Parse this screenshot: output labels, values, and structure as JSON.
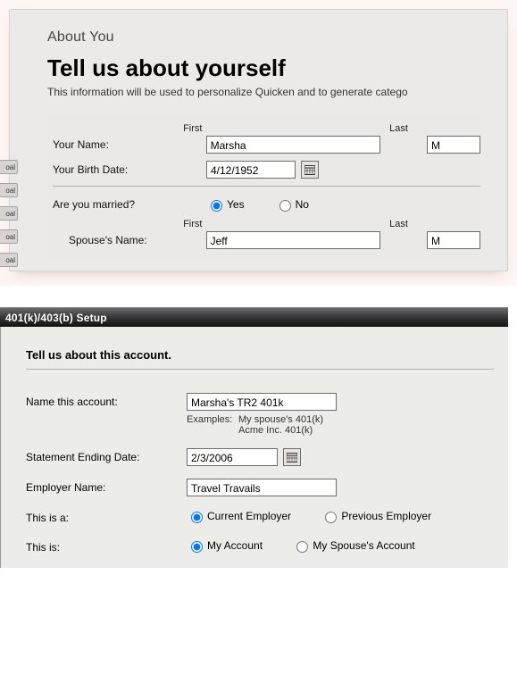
{
  "top": {
    "breadcrumb": "About You",
    "title": "Tell us about yourself",
    "subtitle": "This information will be used to personalize Quicken and to generate catego",
    "side_tab_text": "oal",
    "labels": {
      "your_name": "Your Name:",
      "birth_date": "Your Birth Date:",
      "married_q": "Are you married?",
      "spouse_name": "Spouse's Name:",
      "col_first": "First",
      "col_last": "Last"
    },
    "values": {
      "first": "Marsha",
      "last": "M",
      "birth_date": "4/12/1952",
      "spouse_first": "Jeff",
      "spouse_last": "M"
    },
    "married_options": {
      "yes": "Yes",
      "no": "No"
    },
    "married_selected": "yes"
  },
  "setup": {
    "window_title": "401(k)/403(b) Setup",
    "heading": "Tell us about this account.",
    "labels": {
      "name_account": "Name this account:",
      "examples": "Examples:",
      "example1": "My spouse's 401(k)",
      "example2": "Acme Inc. 401(k)",
      "stmt_date": "Statement Ending Date:",
      "employer": "Employer Name:",
      "this_is_a": "This is a:",
      "this_is": "This is:"
    },
    "values": {
      "account_name": "Marsha's TR2 401k",
      "stmt_date": "2/3/2006",
      "employer": "Travel Travails"
    },
    "employer_options": {
      "current": "Current Employer",
      "previous": "Previous Employer"
    },
    "owner_options": {
      "mine": "My Account",
      "spouse": "My Spouse's Account"
    }
  }
}
